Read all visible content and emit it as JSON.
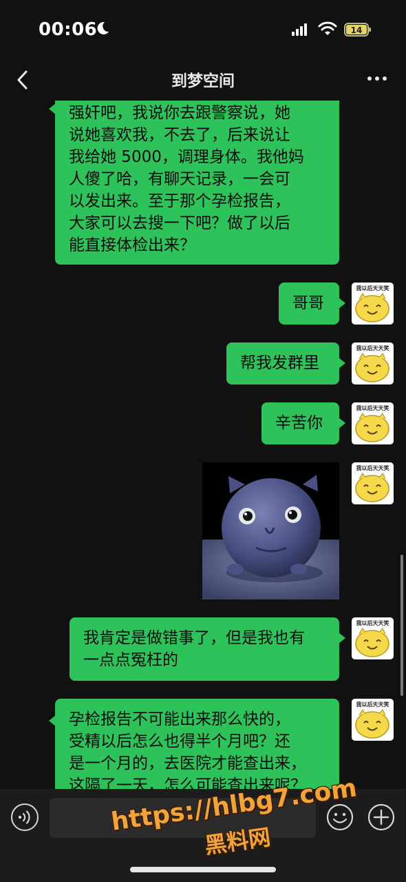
{
  "status_bar": {
    "time": "00:06",
    "battery_level": "14",
    "icons": [
      "moon-icon",
      "cellular-signal-icon",
      "wifi-icon",
      "battery-icon"
    ]
  },
  "nav": {
    "title": "到梦空间",
    "back_icon": "chevron-left-icon",
    "more_icon": "more-horizontal-icon"
  },
  "messages": [
    {
      "side": "left",
      "lines": [
        "强奸吧，我说你去跟警察说，她",
        "说她喜欢我，不去了，后来说让",
        "我给她 5000，调理身体。我他妈",
        "人傻了哈，有聊天记录，一会可",
        "以发出来。至于那个孕检报告，",
        "大家可以去搜一下吧？做了以后",
        "能直接体检出来？"
      ]
    },
    {
      "side": "right",
      "lines": [
        "哥哥"
      ]
    },
    {
      "side": "right",
      "lines": [
        "帮我发群里"
      ]
    },
    {
      "side": "right",
      "lines": [
        "辛苦你"
      ]
    },
    {
      "side": "right",
      "type": "image",
      "image_icon": "round-cat-face-image"
    },
    {
      "side": "right",
      "lines": [
        "我肯定是做错事了，但是我也有",
        "一点点冤枉的"
      ]
    },
    {
      "side": "left",
      "lines": [
        "孕检报告不可能出来那么快的，",
        "受精以后怎么也得半个月吧？还",
        "是一个月的，去医院才能查出来，",
        "这隔了一天，怎么可能查出来呢？"
      ]
    }
  ],
  "avatar": {
    "caption": "我以后天天笑",
    "icon": "smiling-face-sticker-avatar"
  },
  "input_bar": {
    "placeholder": "",
    "voice_icon": "voice-input-icon",
    "emoji_icon": "emoji-icon",
    "plus_icon": "plus-circle-icon"
  },
  "watermark": {
    "url": "https://hlbg7.com",
    "name": "黑料网"
  },
  "colors": {
    "background": "#111111",
    "bubble": "#2ec25b",
    "watermark": "#f2a33a"
  }
}
